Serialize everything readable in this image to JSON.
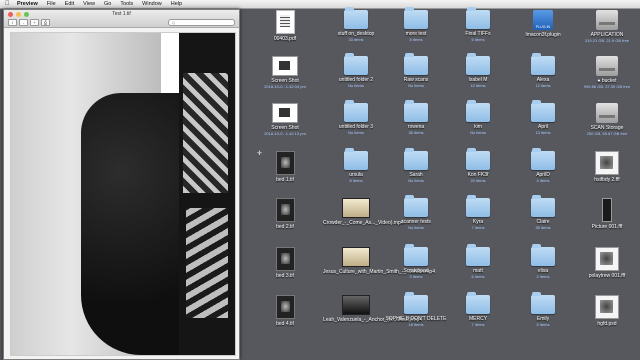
{
  "menubar": {
    "apple": "",
    "items": [
      "Preview",
      "File",
      "Edit",
      "View",
      "Go",
      "Tools",
      "Window",
      "Help"
    ]
  },
  "window": {
    "title": "Test 1.tif",
    "search_placeholder": "Q",
    "tools": [
      "i",
      "-",
      "+",
      "⎙"
    ]
  },
  "desktop": [
    {
      "name": "00403.pdf",
      "sub": "",
      "icon": "pdf-icon"
    },
    {
      "name": "stuff on_desktop",
      "sub": "33 items",
      "icon": "folder-icon"
    },
    {
      "name": "more test",
      "sub": "8 items",
      "icon": "folder-icon"
    },
    {
      "name": "Final TIFFs",
      "sub": "6 items",
      "icon": "folder-icon"
    },
    {
      "name": "Imacon3f.plugin",
      "sub": "",
      "icon": "plugin-icon"
    },
    {
      "name": "APPLICATION",
      "sub": "319.21 GB, 21.9 GB free",
      "icon": "drive-icon"
    },
    {
      "name": "Screen Shot",
      "sub": "2018-10-0...1.42.04 pm",
      "icon": "screenshot-icon"
    },
    {
      "name": "untitled folder 2",
      "sub": "No items",
      "icon": "folder-icon"
    },
    {
      "name": "Raw scans",
      "sub": "No items",
      "icon": "folder-icon"
    },
    {
      "name": "Isabel M",
      "sub": "10 items",
      "icon": "folder-icon"
    },
    {
      "name": "Alexa",
      "sub": "12 items",
      "icon": "folder-icon"
    },
    {
      "name": "● bucket",
      "sub": "999.86 GB, 27.39 GB free",
      "icon": "drive-icon"
    },
    {
      "name": "Screen Shot",
      "sub": "2018-10-0...1.42.13 pm",
      "icon": "screenshot-icon"
    },
    {
      "name": "untitled folder 3",
      "sub": "No items",
      "icon": "folder-icon"
    },
    {
      "name": "rowena",
      "sub": "36 items",
      "icon": "folder-icon"
    },
    {
      "name": "kim",
      "sub": "No items",
      "icon": "folder-icon"
    },
    {
      "name": "April",
      "sub": "13 items",
      "icon": "folder-icon"
    },
    {
      "name": "SCAN Storage",
      "sub": "250 GB, 55.67 GB free",
      "icon": "drive-icon"
    },
    {
      "name": "bed 1.tif",
      "sub": "",
      "icon": "image-file-icon"
    },
    {
      "name": "ursula",
      "sub": "8 items",
      "icon": "folder-icon"
    },
    {
      "name": "Sarah",
      "sub": "No items",
      "icon": "folder-icon"
    },
    {
      "name": "Kon FK3f",
      "sub": "20 items",
      "icon": "folder-icon"
    },
    {
      "name": "AprilD",
      "sub": "4 items",
      "icon": "folder-icon"
    },
    {
      "name": "hsifbdy 2.fff",
      "sub": "",
      "icon": "image-doc-icon"
    },
    {
      "name": "bed 2.tif",
      "sub": "",
      "icon": "image-file-icon"
    },
    {
      "name": "Crowder_-_Come_As..._Video).mp4",
      "sub": "",
      "icon": "video-icon"
    },
    {
      "name": "scanner tests",
      "sub": "No items",
      "icon": "folder-icon"
    },
    {
      "name": "Kyra",
      "sub": "7 items",
      "icon": "folder-icon"
    },
    {
      "name": "Claire",
      "sub": "35 items",
      "icon": "folder-icon"
    },
    {
      "name": "Picture 001.fff",
      "sub": "",
      "icon": "tall-image-icon"
    },
    {
      "name": "bed 3.tif",
      "sub": "",
      "icon": "image-file-icon"
    },
    {
      "name": "Jesus_Culture_with_Martin_Smith_-_...lomon.mp4",
      "sub": "",
      "icon": "video-icon"
    },
    {
      "name": "Scratchpad",
      "sub": "3 items",
      "icon": "folder-icon"
    },
    {
      "name": "matt",
      "sub": "6 items",
      "icon": "folder-icon"
    },
    {
      "name": "elisa",
      "sub": "2 items",
      "icon": "folder-icon"
    },
    {
      "name": "polaytrew 001.fff",
      "sub": "",
      "icon": "image-doc-icon"
    },
    {
      "name": "bed 4.tif",
      "sub": "",
      "icon": "image-file-icon"
    },
    {
      "name": "Leah_Valenzuela_-_Anchor_(B...Music).mp4",
      "sub": "",
      "icon": "video-icon"
    },
    {
      "name": "SOPHIE B DON'T DELETE",
      "sub": "18 items",
      "icon": "folder-icon"
    },
    {
      "name": "MERCY",
      "sub": "7 items",
      "icon": "folder-icon"
    },
    {
      "name": "Emily",
      "sub": "5 items",
      "icon": "folder-icon"
    },
    {
      "name": "hgfd.psd",
      "sub": "",
      "icon": "image-doc-icon"
    }
  ]
}
